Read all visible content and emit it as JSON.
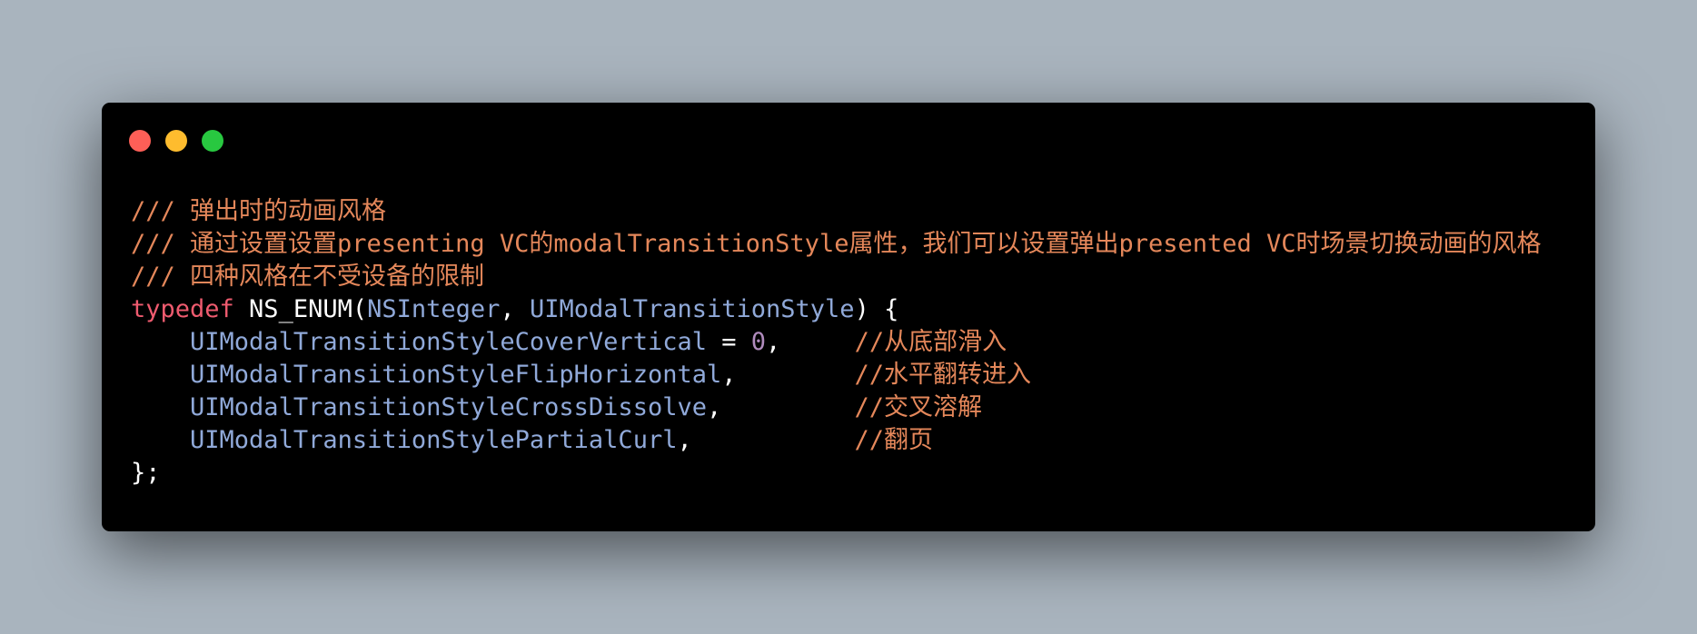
{
  "colors": {
    "background": "#a9b4be",
    "window": "#000000",
    "close": "#fe5f57",
    "minimize": "#febc2e",
    "maximize": "#28c840",
    "comment": "#e4875a",
    "keyword": "#ef5b6f",
    "type": "#90a9d9",
    "number": "#b08bbd",
    "plain": "#ffffff"
  },
  "window_controls": [
    {
      "name": "close-dot",
      "color": "#fe5f57"
    },
    {
      "name": "minimize-dot",
      "color": "#febc2e"
    },
    {
      "name": "maximize-dot",
      "color": "#28c840"
    }
  ],
  "code": {
    "comment1": "/// 弹出时的动画风格",
    "comment2": "/// 通过设置设置presenting VC的modalTransitionStyle属性，我们可以设置弹出presented VC时场景切换动画的风格",
    "comment3": "/// 四种风格在不受设备的限制",
    "decl": {
      "keyword": "typedef",
      "macro": " NS_ENUM(",
      "type1": "NSInteger",
      "comma": ", ",
      "type2": "UIModalTransitionStyle",
      "open": ") {"
    },
    "members": [
      {
        "indent": "    ",
        "name": "UIModalTransitionStyleCoverVertical",
        "assign": " = ",
        "value": "0",
        "pad": ",     ",
        "comment": "//从底部滑入"
      },
      {
        "indent": "    ",
        "name": "UIModalTransitionStyleFlipHorizontal",
        "assign": "",
        "value": "",
        "pad": ",        ",
        "comment": "//水平翻转进入"
      },
      {
        "indent": "    ",
        "name": "UIModalTransitionStyleCrossDissolve",
        "assign": "",
        "value": "",
        "pad": ",         ",
        "comment": "//交叉溶解"
      },
      {
        "indent": "    ",
        "name": "UIModalTransitionStylePartialCurl",
        "assign": "",
        "value": "",
        "pad": ",           ",
        "comment": "//翻页"
      }
    ],
    "close": "};"
  }
}
